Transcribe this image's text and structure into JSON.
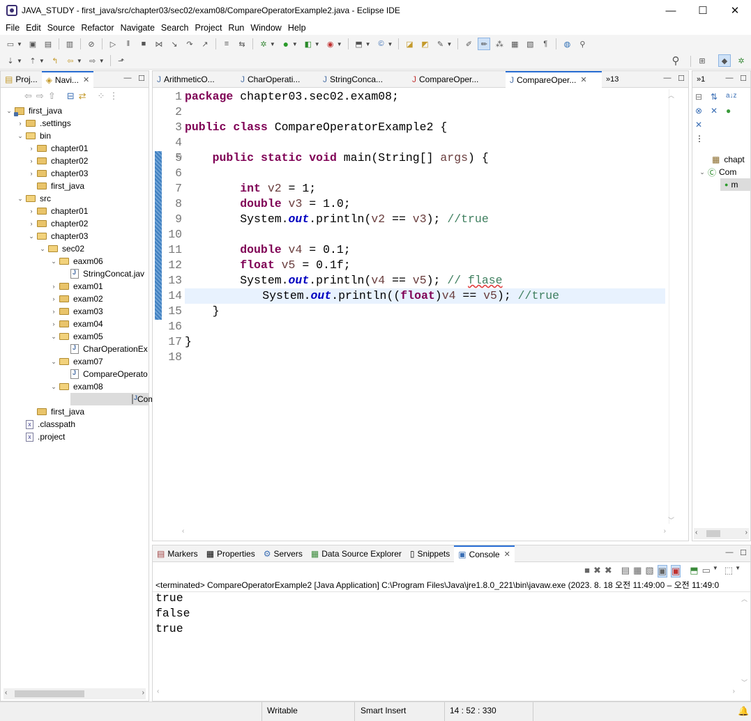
{
  "window": {
    "title": "JAVA_STUDY - first_java/src/chapter03/sec02/exam08/CompareOperatorExample2.java - Eclipse IDE",
    "controls": [
      "—",
      "☐",
      "✕"
    ]
  },
  "menu": [
    "File",
    "Edit",
    "Source",
    "Refactor",
    "Navigate",
    "Search",
    "Project",
    "Run",
    "Window",
    "Help"
  ],
  "left_panel": {
    "tabs": [
      {
        "label": "Proj..."
      },
      {
        "label": "Navi..."
      }
    ],
    "tree": [
      {
        "label": "first_java",
        "indent": 0,
        "type": "project",
        "expanded": true
      },
      {
        "label": ".settings",
        "indent": 1,
        "type": "folder",
        "expanded": false
      },
      {
        "label": "bin",
        "indent": 1,
        "type": "folder",
        "expanded": true
      },
      {
        "label": "chapter01",
        "indent": 2,
        "type": "folder",
        "expanded": false
      },
      {
        "label": "chapter02",
        "indent": 2,
        "type": "folder",
        "expanded": false
      },
      {
        "label": "chapter03",
        "indent": 2,
        "type": "folder",
        "expanded": false
      },
      {
        "label": "first_java",
        "indent": 2,
        "type": "folder",
        "expanded": null
      },
      {
        "label": "src",
        "indent": 1,
        "type": "folder",
        "expanded": true
      },
      {
        "label": "chapter01",
        "indent": 2,
        "type": "folder",
        "expanded": false
      },
      {
        "label": "chapter02",
        "indent": 2,
        "type": "folder",
        "expanded": false
      },
      {
        "label": "chapter03",
        "indent": 2,
        "type": "folder",
        "expanded": true
      },
      {
        "label": "sec02",
        "indent": 3,
        "type": "folder",
        "expanded": true
      },
      {
        "label": "eaxm06",
        "indent": 4,
        "type": "folder",
        "expanded": true
      },
      {
        "label": "StringConcat.jav",
        "indent": 5,
        "type": "java",
        "expanded": null
      },
      {
        "label": "exam01",
        "indent": 4,
        "type": "folder",
        "expanded": false
      },
      {
        "label": "exam02",
        "indent": 4,
        "type": "folder",
        "expanded": false
      },
      {
        "label": "exam03",
        "indent": 4,
        "type": "folder",
        "expanded": false
      },
      {
        "label": "exam04",
        "indent": 4,
        "type": "folder",
        "expanded": false
      },
      {
        "label": "exam05",
        "indent": 4,
        "type": "folder",
        "expanded": true
      },
      {
        "label": "CharOperationEx",
        "indent": 5,
        "type": "java",
        "expanded": null
      },
      {
        "label": "exam07",
        "indent": 4,
        "type": "folder",
        "expanded": true
      },
      {
        "label": "CompareOperato",
        "indent": 5,
        "type": "java",
        "expanded": null
      },
      {
        "label": "exam08",
        "indent": 4,
        "type": "folder",
        "expanded": true
      },
      {
        "label": "CompareOperato",
        "indent": 5,
        "type": "java",
        "expanded": null,
        "selected": true
      },
      {
        "label": "first_java",
        "indent": 2,
        "type": "folder",
        "expanded": null
      },
      {
        "label": ".classpath",
        "indent": 1,
        "type": "xml",
        "expanded": null
      },
      {
        "label": ".project",
        "indent": 1,
        "type": "xml",
        "expanded": null
      }
    ]
  },
  "editor": {
    "tabs": [
      {
        "label": "ArithmeticO..."
      },
      {
        "label": "CharOperati..."
      },
      {
        "label": "StringConca..."
      },
      {
        "label": "CompareOper..."
      },
      {
        "label": "CompareOper...",
        "active": true
      }
    ],
    "overflow_label": "»13",
    "current_line": 14,
    "lines": [
      {
        "n": "1",
        "html": "<span class='kw'>package</span> chapter03.sec02.exam08;"
      },
      {
        "n": "2",
        "html": ""
      },
      {
        "n": "3",
        "html": "<span class='kw'>public</span> <span class='kw'>class</span> CompareOperatorExample2 {"
      },
      {
        "n": "4",
        "html": ""
      },
      {
        "n": "5",
        "html": "    <span class='kw'>public</span> <span class='kw'>static</span> <span class='kw'>void</span> main(String[] <span class='var'>args</span>) {"
      },
      {
        "n": "6",
        "html": ""
      },
      {
        "n": "7",
        "html": "        <span class='kw'>int</span> <span class='var'>v2</span> = 1;"
      },
      {
        "n": "8",
        "html": "        <span class='kw'>double</span> <span class='var'>v3</span> = 1.0;"
      },
      {
        "n": "9",
        "html": "        System.<span class='sf'>out</span>.println(<span class='var'>v2</span> == <span class='var'>v3</span>); <span class='cm'>//true</span>"
      },
      {
        "n": "10",
        "html": ""
      },
      {
        "n": "11",
        "html": "        <span class='kw'>double</span> <span class='var'>v4</span> = 0.1;"
      },
      {
        "n": "12",
        "html": "        <span class='kw'>float</span> <span class='var'>v5</span> = 0.1f;"
      },
      {
        "n": "13",
        "html": "        System.<span class='sf'>out</span>.println(<span class='var'>v4</span> == <span class='var'>v5</span>); <span class='cm'>// <span class='spell'>flase</span></span>"
      },
      {
        "n": "14",
        "html": "        System.<span class='sf'>out</span>.println((<span class='kw'>float</span>)<span class='var'>v4</span> == <span class='var'>v5</span>); <span class='cm'>//true</span>"
      },
      {
        "n": "15",
        "html": "    }"
      },
      {
        "n": "16",
        "html": ""
      },
      {
        "n": "17",
        "html": "}"
      },
      {
        "n": "18",
        "html": ""
      }
    ]
  },
  "outline": {
    "overflow_label": "»1",
    "items": [
      {
        "label": "chapt"
      },
      {
        "label": "Com"
      },
      {
        "label": "m"
      }
    ]
  },
  "bottom_panel": {
    "tabs": [
      {
        "label": "Markers"
      },
      {
        "label": "Properties"
      },
      {
        "label": "Servers"
      },
      {
        "label": "Data Source Explorer"
      },
      {
        "label": "Snippets"
      },
      {
        "label": "Console",
        "active": true
      }
    ],
    "launch_info": "<terminated> CompareOperatorExample2 [Java Application] C:\\Program Files\\Java\\jre1.8.0_221\\bin\\javaw.exe  (2023. 8. 18 오전 11:49:00 – 오전 11:49:0",
    "output": [
      "true",
      "false",
      "true"
    ]
  },
  "status": {
    "writable": "Writable",
    "insert_mode": "Smart Insert",
    "position": "14 : 52 : 330"
  }
}
